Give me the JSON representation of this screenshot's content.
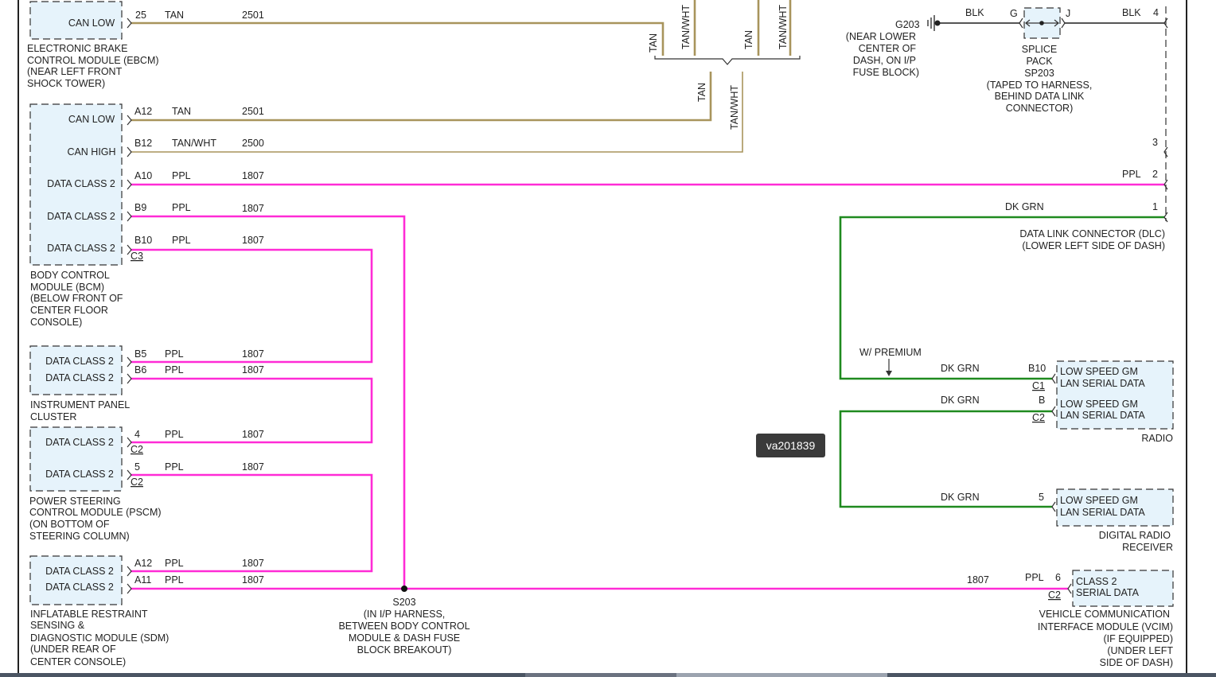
{
  "wire_colors": {
    "tan": "#a8945c",
    "ppl": "#ff2bd6",
    "dkgrn": "#1f8a1f",
    "blk": "#555555",
    "frame": "#222222",
    "module_fill": "#e6f3fb"
  },
  "badge": "va201839",
  "labels": {
    "tan": "TAN",
    "tanwht": "TAN/WHT",
    "ppl": "PPL",
    "dkgrn": "DK GRN",
    "blk": "BLK",
    "circuit_2501": "2501",
    "circuit_2500": "2500",
    "circuit_1807": "1807",
    "can_low": "CAN LOW",
    "can_high": "CAN HIGH",
    "data_class_2": "DATA CLASS 2",
    "lan_1": "LOW SPEED GM",
    "lan_2": "LAN SERIAL DATA",
    "class2_1": "CLASS 2",
    "class2_2": "SERIAL DATA",
    "w_premium": "W/ PREMIUM",
    "g203": "G203",
    "g": "G",
    "j": "J"
  },
  "pins": {
    "ebcm_can_low": "25",
    "bcm_a12": "A12",
    "bcm_b12": "B12",
    "bcm_a10": "A10",
    "bcm_b9": "B9",
    "bcm_b10": "B10",
    "bcm_conn": "C3",
    "ipc_b5": "B5",
    "ipc_b6": "B6",
    "pscm_4": "4",
    "pscm_5": "5",
    "pscm_conn": "C2",
    "sdm_a12": "A12",
    "sdm_a11": "A11",
    "dlc_4": "4",
    "dlc_3": "3",
    "dlc_2": "2",
    "dlc_1": "1",
    "radio_b10": "B10",
    "radio_c1": "C1",
    "radio_b": "B",
    "radio_c2": "C2",
    "drr_5": "5",
    "vcim_6": "6",
    "vcim_c2": "C2"
  },
  "captions": {
    "ebcm": [
      "ELECTRONIC BRAKE",
      "CONTROL MODULE (EBCM)",
      "(NEAR LEFT FRONT",
      "SHOCK TOWER)"
    ],
    "bcm": [
      "BODY CONTROL",
      "MODULE (BCM)",
      "(BELOW FRONT OF",
      "CENTER FLOOR",
      "CONSOLE)"
    ],
    "ipc": [
      "INSTRUMENT PANEL",
      "CLUSTER"
    ],
    "pscm": [
      "POWER STEERING",
      "CONTROL MODULE (PSCM)",
      "(ON BOTTOM OF",
      "STEERING COLUMN)"
    ],
    "sdm": [
      "INFLATABLE RESTRAINT",
      "SENSING &",
      "DIAGNOSTIC MODULE (SDM)",
      "(UNDER REAR OF",
      "CENTER CONSOLE)"
    ],
    "s203": [
      "S203",
      "(IN I/P HARNESS,",
      "BETWEEN BODY CONTROL",
      "MODULE & DASH FUSE",
      "BLOCK BREAKOUT)"
    ],
    "g203": [
      "(NEAR LOWER",
      "CENTER OF",
      "DASH, ON I/P",
      "FUSE BLOCK)"
    ],
    "splice": [
      "SPLICE",
      "PACK",
      "SP203",
      "(TAPED TO HARNESS,",
      "BEHIND DATA LINK",
      "CONNECTOR)"
    ],
    "dlc": [
      "DATA LINK CONNECTOR (DLC)",
      "(LOWER LEFT SIDE OF DASH)"
    ],
    "radio": [
      "RADIO"
    ],
    "drr": [
      "DIGITAL RADIO",
      "RECEIVER"
    ],
    "vcim": [
      "VEHICLE COMMUNICATION",
      "INTERFACE MODULE (VCIM)",
      "(IF EQUIPPED)",
      "(UNDER LEFT",
      "SIDE OF DASH)"
    ]
  }
}
